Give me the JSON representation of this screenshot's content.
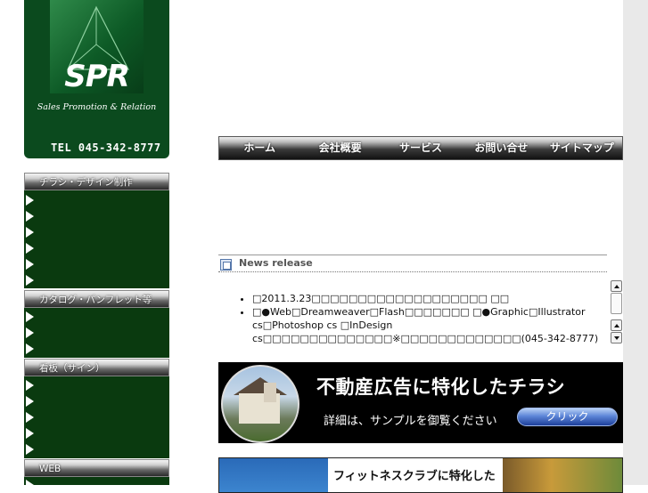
{
  "logo": {
    "brand": "SPR",
    "tagline": "Sales Promotion & Relation",
    "phone": "TEL 045-342-8777"
  },
  "sidebar": {
    "sections": [
      {
        "title": "チラシ・デザイン制作",
        "items": 6
      },
      {
        "title": "カタログ・パンフレット等",
        "items": 3
      },
      {
        "title": "看板（サイン）",
        "items": 5
      },
      {
        "title": "WEB",
        "items": 1
      }
    ]
  },
  "nav": {
    "items": [
      "ホーム",
      "会社概要",
      "サービス",
      "お問い合せ",
      "サイトマップ"
    ]
  },
  "news": {
    "title": "News release",
    "items": [
      "□2011.3.23□□□□□□□□□□□□□□□□□□□ □□",
      "□●Web□Dreamweaver□Flash□□□□□□□ □●Graphic□Illustrator cs□Photoshop cs □InDesign cs□□□□□□□□□□□□□□※□□□□□□□□□□□□□(045-342-8777)"
    ]
  },
  "banners": {
    "realestate": {
      "title": "不動産広告に特化したチラシ",
      "subtitle": "詳細は、サンプルを御覧ください",
      "button": "クリック"
    },
    "fitness": {
      "title": "フィットネスクラブに特化した"
    }
  },
  "colors": {
    "dark_green": "#0a3a0f",
    "logo_green": "#0b4a1e",
    "nav_black": "#111111",
    "button_blue": "#3d6cc8"
  }
}
